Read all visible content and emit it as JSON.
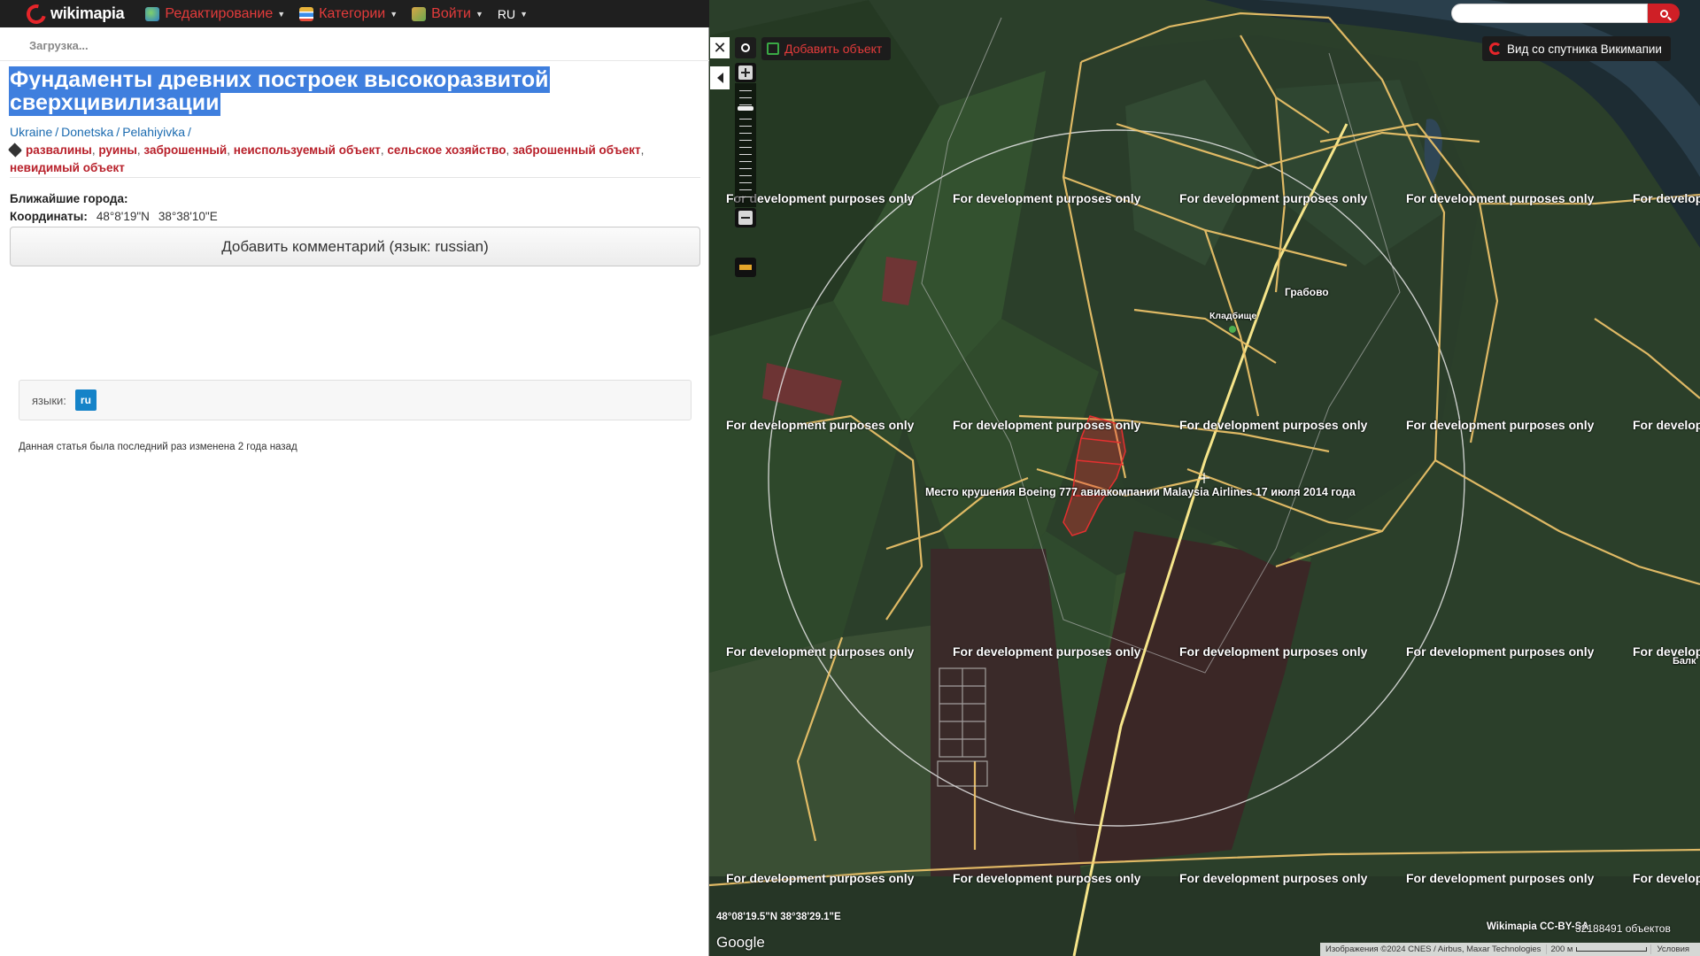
{
  "topbar": {
    "logo": "wikimapia",
    "nav": [
      {
        "label": "Редактирование",
        "icon": "globe-edit-icon",
        "color": "#e33b3b"
      },
      {
        "label": "Категории",
        "icon": "categories-icon",
        "color": "#e33b3b"
      },
      {
        "label": "Войти",
        "icon": "login-icon",
        "color": "#e33b3b"
      }
    ],
    "lang": "RU"
  },
  "panel": {
    "loading": "Загрузка...",
    "title": [
      "Фундаменты древних построек высокоразвитой",
      "сверхцивилизации"
    ],
    "breadcrumbs": [
      "Ukraine",
      "Donetska",
      "Pelahiyivka"
    ],
    "tags": [
      "развалины",
      "руины",
      "заброшенный",
      "неиспользуемый объект",
      "сельское хозяйство",
      "заброшенный объект",
      "невидимый объект"
    ],
    "nearest_cities_label": "Ближайшие города:",
    "coords_label": "Координаты:",
    "lat": "48°8'19\"N",
    "lon": "38°38'10\"E",
    "add_comment": "Добавить комментарий (язык: russian)",
    "languages_label": "языки:",
    "language_badge": "ru",
    "modified": "Данная статья была последний раз изменена 2 года назад"
  },
  "map": {
    "close_label": "✕",
    "add_object": "Добавить объект",
    "satellite_toggle": "Вид со спутника Викимапии",
    "search_placeholder": "",
    "watermark": "For development purposes only",
    "labels": {
      "village": "Грабово",
      "cemetery": "Кладбище",
      "crash_site": "Место крушения Boeing 777 авиакомпании Malaysia Airlines 17 июля 2014 года",
      "edge": "Балк"
    },
    "coord_readout": "48°08'19.5\"N 38°38'29.1\"E",
    "google": "Google",
    "license": "Wikimapia CC-BY-SA",
    "object_count": "32188491 объектов",
    "imagery_attribution": "Изображения ©2024 CNES / Airbus, Maxar Technologies",
    "scale": "200 м",
    "terms": "Условия",
    "colors": {
      "road": "#f3c76b",
      "major_road": "#f6e58a",
      "selected_polygon": "#e53030",
      "accent": "#cf1f26"
    }
  }
}
